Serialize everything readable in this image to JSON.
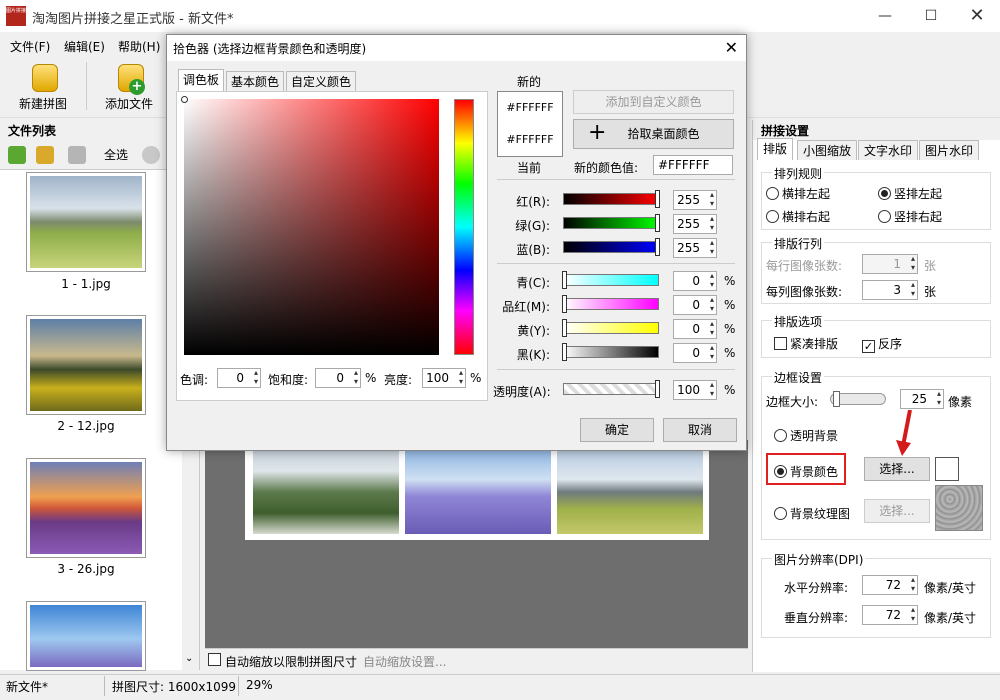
{
  "window": {
    "title": "淘淘图片拼接之星正式版 - 新文件*",
    "app_icon_text": "图片拼接"
  },
  "menu": [
    "文件(F)",
    "编辑(E)",
    "帮助(H)"
  ],
  "toolbar": {
    "new_label": "新建拼图",
    "add_label": "添加文件"
  },
  "file_list": {
    "header": "文件列表",
    "select_all": "全选",
    "files": [
      "1 - 1.jpg",
      "2 - 12.jpg",
      "3 - 26.jpg"
    ]
  },
  "color_dialog": {
    "title": "拾色器 (选择边框背景颜色和透明度)",
    "tabs": [
      "调色板",
      "基本颜色",
      "自定义颜色"
    ],
    "new_label": "新的",
    "current_label": "当前",
    "new_color": "#FFFFFF",
    "current_color": "#FFFFFF",
    "add_custom": "添加到自定义颜色",
    "pick_desktop": "拾取桌面颜色",
    "new_value_label": "新的颜色值:",
    "new_value": "#FFFFFF",
    "rgb": [
      {
        "label": "红(R):",
        "value": "255"
      },
      {
        "label": "绿(G):",
        "value": "255"
      },
      {
        "label": "蓝(B):",
        "value": "255"
      }
    ],
    "cmyk": [
      {
        "label": "青(C):",
        "value": "0"
      },
      {
        "label": "品红(M):",
        "value": "0"
      },
      {
        "label": "黄(Y):",
        "value": "0"
      },
      {
        "label": "黑(K):",
        "value": "0"
      }
    ],
    "percent": "%",
    "opacity_label": "透明度(A):",
    "opacity_value": "100",
    "hue_label": "色调:",
    "hue_value": "0",
    "sat_label": "饱和度:",
    "sat_value": "0",
    "bri_label": "亮度:",
    "bri_value": "100",
    "ok": "确定",
    "cancel": "取消"
  },
  "canvas": {
    "auto_zoom_label": "自动缩放以限制拼图尺寸",
    "auto_zoom_settings": "自动缩放设置..."
  },
  "settings": {
    "header": "拼接设置",
    "tabs": [
      "排版",
      "小图缩放",
      "文字水印",
      "图片水印"
    ],
    "arrange": {
      "title": "排列规则",
      "options": [
        "横排左起",
        "竖排左起",
        "横排右起",
        "竖排右起"
      ],
      "selected": "竖排左起"
    },
    "rows": {
      "title": "排版行列",
      "per_row_label": "每行图像张数:",
      "per_row": "1",
      "per_col_label": "每列图像张数:",
      "per_col": "3",
      "unit": "张"
    },
    "options": {
      "title": "排版选项",
      "compact": "紧凑排版",
      "compact_checked": false,
      "reverse": "反序",
      "reverse_checked": true
    },
    "border": {
      "title": "边框设置",
      "size_label": "边框大小:",
      "size_value": "25",
      "unit": "像素",
      "transparent": "透明背景",
      "bg_color": "背景颜色",
      "bg_texture": "背景纹理图",
      "choose": "选择...",
      "selected": "背景颜色",
      "swatch": "#FFFFFF"
    },
    "dpi": {
      "title": "图片分辨率(DPI)",
      "h_label": "水平分辨率:",
      "h_value": "72",
      "v_label": "垂直分辨率:",
      "v_value": "72",
      "unit": "像素/英寸"
    }
  },
  "status": {
    "file": "新文件*",
    "size": "拼图尺寸: 1600x1099",
    "zoom": "29%"
  },
  "colors": {
    "highlight": "#e02020",
    "arrow": "#d31b1b"
  }
}
